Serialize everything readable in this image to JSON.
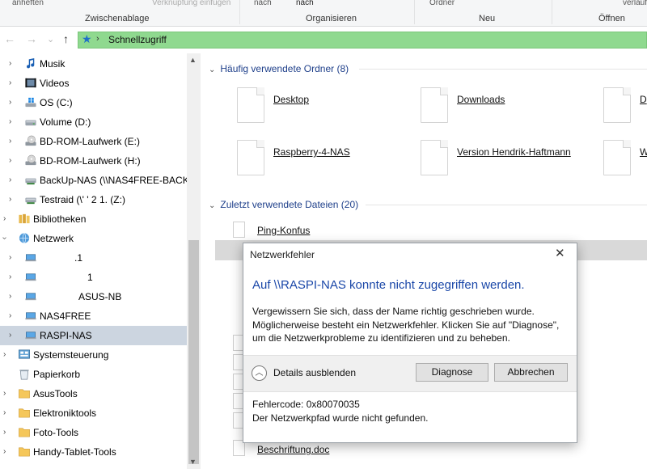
{
  "ribbon": {
    "top_texts": [
      "anheften",
      "Verknüpfung einfügen",
      "nach",
      "nach",
      "Ordner",
      "verlauf"
    ],
    "groups": [
      "Zwischenablage",
      "Organisieren",
      "Neu",
      "Öffnen"
    ]
  },
  "nav": {
    "back": "←",
    "forward": "→",
    "recent": "⌄",
    "up": "↑"
  },
  "address": {
    "chevron": "›",
    "location": "Schnellzugriff"
  },
  "tree": {
    "items": [
      {
        "label": "Musik",
        "icon": "music-icon"
      },
      {
        "label": "Videos",
        "icon": "video-icon"
      },
      {
        "label": "OS (C:)",
        "icon": "drive-icon"
      },
      {
        "label": "Volume (D:)",
        "icon": "drive-icon"
      },
      {
        "label": "BD-ROM-Laufwerk (E:)",
        "icon": "disc-drive-icon"
      },
      {
        "label": "BD-ROM-Laufwerk (H:)",
        "icon": "disc-drive-icon"
      },
      {
        "label": "BackUp-NAS (\\\\NAS4FREE-BACKU",
        "icon": "network-drive-icon"
      },
      {
        "label": "Testraid (\\'  ' 2 1.          (Z:)",
        "icon": "network-drive-icon"
      },
      {
        "label": "Bibliotheken",
        "icon": "libraries-icon"
      },
      {
        "label": "Netzwerk",
        "icon": "network-icon"
      },
      {
        "label": ".1",
        "icon": "computer-icon"
      },
      {
        "label": "1",
        "icon": "computer-icon"
      },
      {
        "label": "ASUS-NB",
        "icon": "computer-icon"
      },
      {
        "label": "NAS4FREE",
        "icon": "computer-icon"
      },
      {
        "label": "RASPI-NAS",
        "icon": "computer-icon"
      },
      {
        "label": "Systemsteuerung",
        "icon": "control-panel-icon"
      },
      {
        "label": "Papierkorb",
        "icon": "recycle-bin-icon"
      },
      {
        "label": "AsusTools",
        "icon": "folder-icon"
      },
      {
        "label": "Elektroniktools",
        "icon": "folder-icon"
      },
      {
        "label": "Foto-Tools",
        "icon": "folder-icon"
      },
      {
        "label": "Handy-Tablet-Tools",
        "icon": "folder-icon"
      }
    ]
  },
  "main": {
    "frequent_header": "Häufig verwendete Ordner (8)",
    "frequent": [
      {
        "name": "Desktop"
      },
      {
        "name": "Downloads"
      },
      {
        "name": "D"
      },
      {
        "name": "Raspberry-4-NAS"
      },
      {
        "name": "Version Hendrik-Haftmann"
      },
      {
        "name": "W"
      }
    ],
    "recent_header": "Zuletzt verwendete Dateien (20)",
    "recent": [
      {
        "name": "Ping-Konfus"
      },
      {
        "name": "Beschriftung.doc"
      }
    ]
  },
  "dialog": {
    "title": "Netzwerkfehler",
    "close": "✕",
    "heading": "Auf \\\\RASPI-NAS konnte nicht zugegriffen werden.",
    "body": [
      "Vergewissern Sie sich, dass der Name richtig geschrieben wurde.",
      "Möglicherweise besteht ein Netzwerkfehler. Klicken Sie auf \"Diagnose\",",
      "um die Netzwerkprobleme zu identifizieren und zu beheben."
    ],
    "details_label": "Details ausblenden",
    "diagnose_label": "Diagnose",
    "cancel_label": "Abbrechen",
    "error_code": "Fehlercode: 0x80070035",
    "error_text": "Der Netzwerkpfad wurde nicht gefunden."
  }
}
